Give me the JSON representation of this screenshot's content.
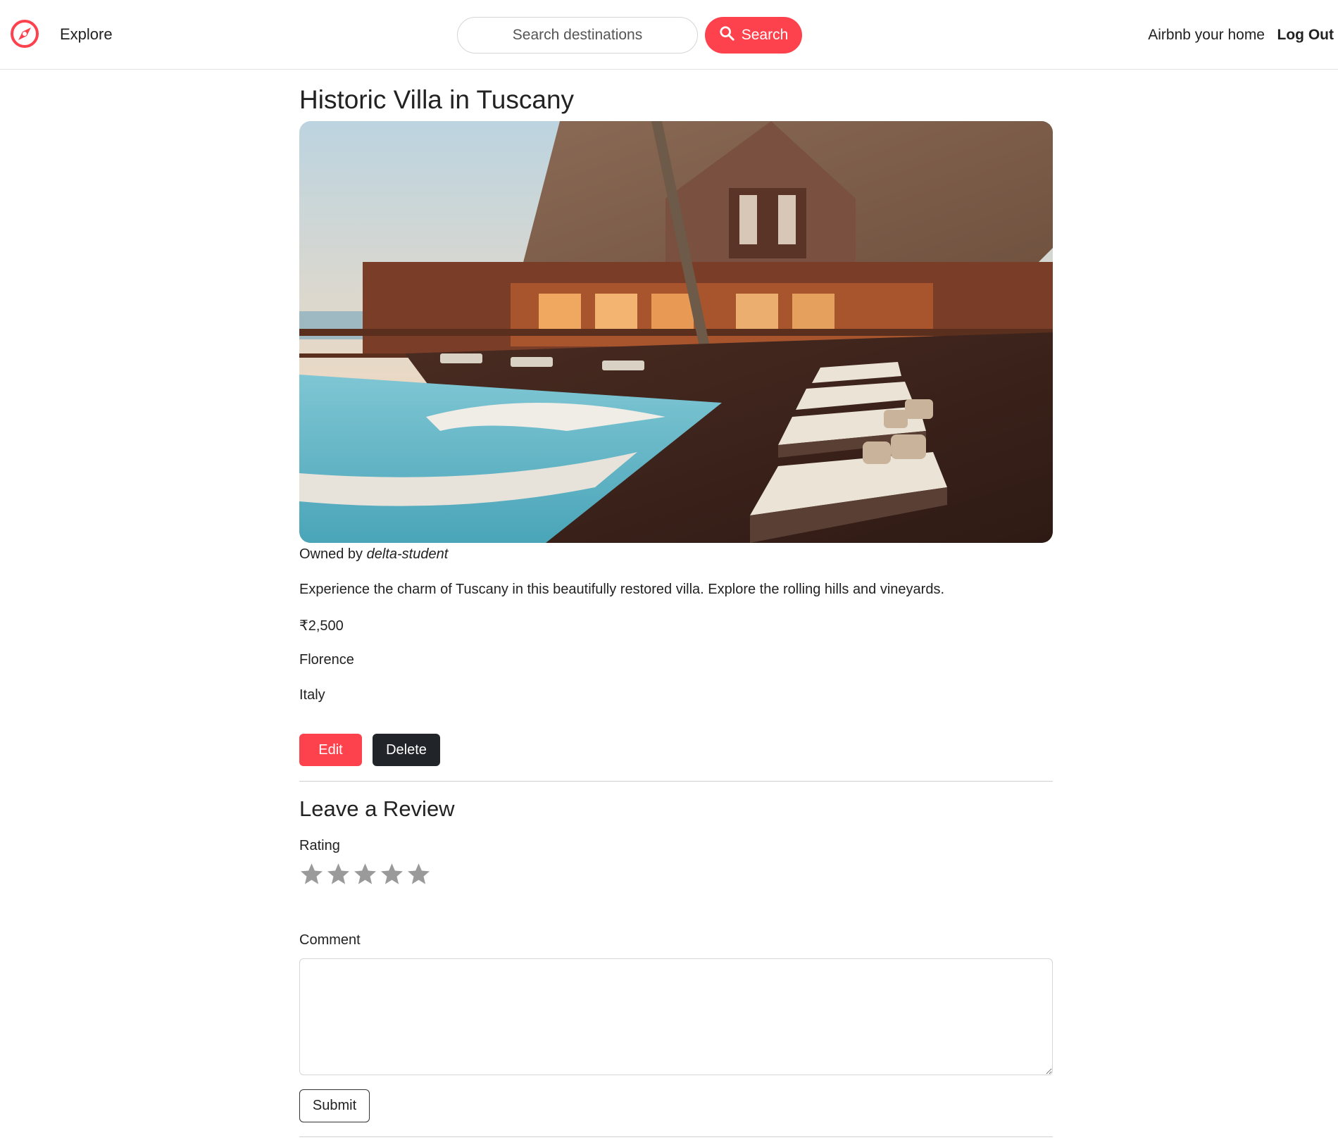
{
  "navbar": {
    "logo_icon": "compass-icon",
    "explore_label": "Explore",
    "search_placeholder": "Search destinations",
    "search_button_label": "Search",
    "search_icon": "search-icon",
    "host_label": "Airbnb your home",
    "logout_label": "Log Out"
  },
  "listing": {
    "title": "Historic Villa in Tuscany",
    "image_alt": "villa-with-pool-and-lounge-chairs",
    "owner_prefix": "Owned by",
    "owner_name": "delta-student",
    "description": "Experience the charm of Tuscany in this beautifully restored villa. Explore the rolling hills and vineyards.",
    "price": "₹2,500",
    "location": "Florence",
    "country": "Italy",
    "edit_label": "Edit",
    "delete_label": "Delete"
  },
  "review": {
    "heading": "Leave a Review",
    "rating_label": "Rating",
    "star_count": 5,
    "star_icon": "star-icon",
    "comment_label": "Comment",
    "comment_value": "",
    "submit_label": "Submit"
  },
  "colors": {
    "brand": "#fe424d",
    "dark_button": "#212529",
    "star_empty": "#9a9a9a"
  }
}
